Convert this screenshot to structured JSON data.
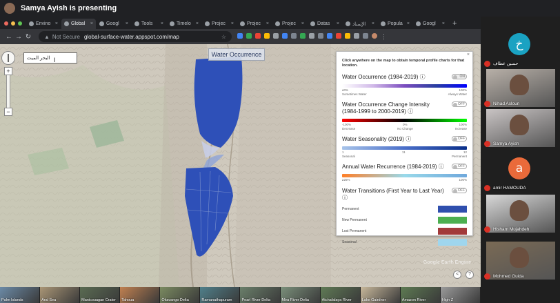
{
  "meeting": {
    "presenter_banner": "Samya Ayish is presenting"
  },
  "browser": {
    "tabs": [
      {
        "label": "Envino",
        "active": false
      },
      {
        "label": "Global",
        "active": true
      },
      {
        "label": "Googl",
        "active": false
      },
      {
        "label": "Tools",
        "active": false
      },
      {
        "label": "Timelo",
        "active": false
      },
      {
        "label": "Projec",
        "active": false
      },
      {
        "label": "Projec",
        "active": false
      },
      {
        "label": "Projec",
        "active": false
      },
      {
        "label": "Datas",
        "active": false
      },
      {
        "label": "الإسناد",
        "active": false
      },
      {
        "label": "Popula",
        "active": false
      },
      {
        "label": "Googl",
        "active": false
      }
    ],
    "tab_close_glyph": "×",
    "new_tab_glyph": "+",
    "address": {
      "security": "Not Secure",
      "url": "global-surface-water.appspot.com/map"
    }
  },
  "map": {
    "search_value": "البحر الميت",
    "overlay_title": "Water Occurrence",
    "watermark": "Google Earth Engine"
  },
  "panel": {
    "close_glyph": "×",
    "note": "Click anywhere on the map to obtain temporal profile charts for that location.",
    "layers": [
      {
        "title": "Water Occurrence (1984-2019) ⓘ",
        "toggle": "ON",
        "labels": [
          "≤0%",
          "",
          "100%"
        ],
        "sublabels": [
          "Sometimes Water",
          "",
          "Always Water"
        ],
        "colors": [
          "#ffffff",
          "#d0b8e8",
          "#7b4dbf",
          "#2a3fa0",
          "#0000ff"
        ]
      },
      {
        "title": "Water Occurrence Change Intensity (1984-1999 to 2000-2019) ⓘ",
        "toggle": "OFF",
        "labels": [
          "-100%",
          "0%",
          "100%"
        ],
        "sublabels": [
          "Decrease",
          "No Change",
          "Increase"
        ],
        "colors": [
          "#ff0000",
          "#000000",
          "#00ff00"
        ]
      },
      {
        "title": "Water Seasonality (2019) ⓘ",
        "toggle": "OFF",
        "labels": [
          "1",
          "11",
          "12"
        ],
        "sublabels": [
          "Seasonal",
          "",
          "Permanent"
        ],
        "colors": [
          "#a8c4ea",
          "#4a6fc9",
          "#0a2f8a"
        ]
      },
      {
        "title": "Annual Water Recurrence (1984-2019) ⓘ",
        "toggle": "OFF",
        "labels": [
          "≥25%",
          "",
          "100%"
        ],
        "sublabels": [
          "",
          "",
          ""
        ],
        "colors": [
          "#ff7f27",
          "#99d9ea",
          "#6fa8dc"
        ]
      },
      {
        "title": "Water Transitions (First Year to Last Year) ⓘ",
        "toggle": "OFF",
        "labels": [],
        "sublabels": [],
        "colors": []
      }
    ],
    "transitions": [
      {
        "label": "Permanent",
        "color": "#2f4fae"
      },
      {
        "label": "New Permanent",
        "color": "#4caf50"
      },
      {
        "label": "Lost Permanent",
        "color": "#a23a3a"
      },
      {
        "label": "Seasonal",
        "color": "#9fd6ee"
      }
    ]
  },
  "thumbnails": [
    {
      "label": "Palm Islands",
      "color": "#6b8aa6"
    },
    {
      "label": "Aral Sea",
      "color": "#a99575"
    },
    {
      "label": "Manicouagan Crater",
      "color": "#5a6b52"
    },
    {
      "label": "Tahoua",
      "color": "#c08050"
    },
    {
      "label": "Okavango Delta",
      "color": "#7a8a60"
    },
    {
      "label": "Ramanathapuram",
      "color": "#4f7f8a"
    },
    {
      "label": "Pearl River Delta",
      "color": "#6a7f6a"
    },
    {
      "label": "Mira River Delta",
      "color": "#7a8f7a"
    },
    {
      "label": "Atchafalaya River",
      "color": "#5f7a55"
    },
    {
      "label": "Lake Gairdner",
      "color": "#c7b79a"
    },
    {
      "label": "Amazon River",
      "color": "#5d7a52"
    },
    {
      "label": "High Z",
      "color": "#9a9a9a"
    }
  ],
  "participants": [
    {
      "name": "حسين عطاف",
      "kind": "letter",
      "letter": "خ",
      "color": "#1aa2c2"
    },
    {
      "name": "Nihad Asloun",
      "kind": "video",
      "color": "#b8b0a8"
    },
    {
      "name": "Samya Ayish",
      "kind": "video",
      "color": "#c9c4c4"
    },
    {
      "name": "amir HAMOUDA",
      "kind": "letter",
      "letter": "a",
      "color": "#ea6a3a"
    },
    {
      "name": "Hisham Mujahdeh",
      "kind": "video",
      "color": "#d8d8d8"
    },
    {
      "name": "Mohmed Guida",
      "kind": "video",
      "color": "#7a6a55"
    }
  ]
}
